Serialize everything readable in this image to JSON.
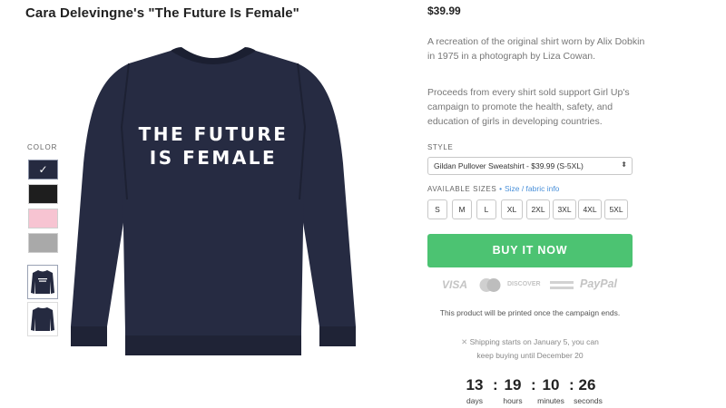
{
  "product": {
    "title": "Cara Delevingne's \"The Future Is Female\"",
    "shirt_line1": "THE FUTURE",
    "shirt_line2": "IS FEMALE",
    "shirt_color": "#252a40"
  },
  "color_picker": {
    "label": "COLOR",
    "swatches": [
      {
        "name": "navy",
        "hex": "#252a40",
        "selected": true
      },
      {
        "name": "black",
        "hex": "#1e1e1e",
        "selected": false
      },
      {
        "name": "pink",
        "hex": "#f7c4d2",
        "selected": false
      },
      {
        "name": "heather-grey",
        "hex": "#a9a9a9",
        "selected": false
      }
    ],
    "check_glyph": "✓"
  },
  "price": "$39.99",
  "description": {
    "para1": "A recreation of the original shirt worn by Alix Dobkin in 1975 in a photograph by Liza Cowan.",
    "para2": "Proceeds from every shirt sold support Girl Up's campaign to promote the health, safety, and education of girls in developing countries."
  },
  "style": {
    "label": "STYLE",
    "selected": "Gildan Pullover Sweatshirt - $39.99 (S-5XL)"
  },
  "sizes": {
    "label": "AVAILABLE SIZES",
    "separator": "•",
    "link": "Size / fabric info",
    "options": [
      "S",
      "M",
      "L",
      "XL",
      "2XL",
      "3XL",
      "4XL",
      "5XL"
    ]
  },
  "buy_button": "BUY IT NOW",
  "payments": [
    "VISA",
    "DISCOVER",
    "PayPal"
  ],
  "print_note": "This product will be printed once the campaign ends.",
  "shipping": {
    "line1": "Shipping starts on January 5, you can",
    "line2": "keep buying until December 20"
  },
  "countdown": {
    "days": "13",
    "hours": "19",
    "minutes": "10",
    "seconds": "26",
    "days_label": "days",
    "hours_label": "hours",
    "minutes_label": "minutes",
    "seconds_label": "seconds"
  },
  "colors": {
    "buy": "#4cc372",
    "link": "#4a90d9"
  }
}
